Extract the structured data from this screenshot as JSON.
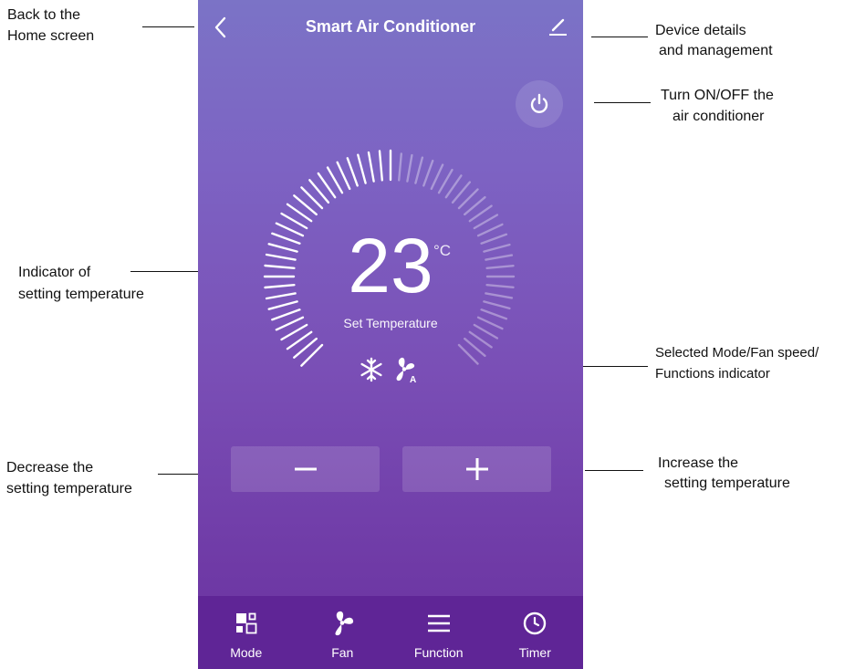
{
  "app": {
    "title": "Smart Air Conditioner"
  },
  "temperature": {
    "value": "23",
    "unit": "°C",
    "label": "Set Temperature"
  },
  "indicators": [
    "snowflake-icon",
    "fan-auto-icon"
  ],
  "buttons": {
    "decrease": "minus-icon",
    "increase": "plus-icon",
    "power": "power-icon"
  },
  "tabs": [
    {
      "label": "Mode",
      "icon": "mode-icon"
    },
    {
      "label": "Fan",
      "icon": "fan-icon"
    },
    {
      "label": "Function",
      "icon": "menu-icon"
    },
    {
      "label": "Timer",
      "icon": "clock-icon"
    }
  ],
  "annotations": {
    "back": [
      "Back to the",
      "Home screen"
    ],
    "device": [
      "Device details",
      "and management"
    ],
    "power": [
      "Turn ON/OFF the",
      "air conditioner"
    ],
    "indicator": [
      "Indicator of",
      "setting temperature"
    ],
    "mode": [
      "Selected Mode/Fan speed/",
      "Functions indicator"
    ],
    "decrease": [
      "Decrease the",
      "setting temperature"
    ],
    "increase": [
      "Increase the",
      "setting temperature"
    ]
  },
  "colors": {
    "gradient_top": "#7b73c6",
    "gradient_bottom": "#6a33a0",
    "tabbar": "#5f2596",
    "foreground": "#ffffff"
  }
}
